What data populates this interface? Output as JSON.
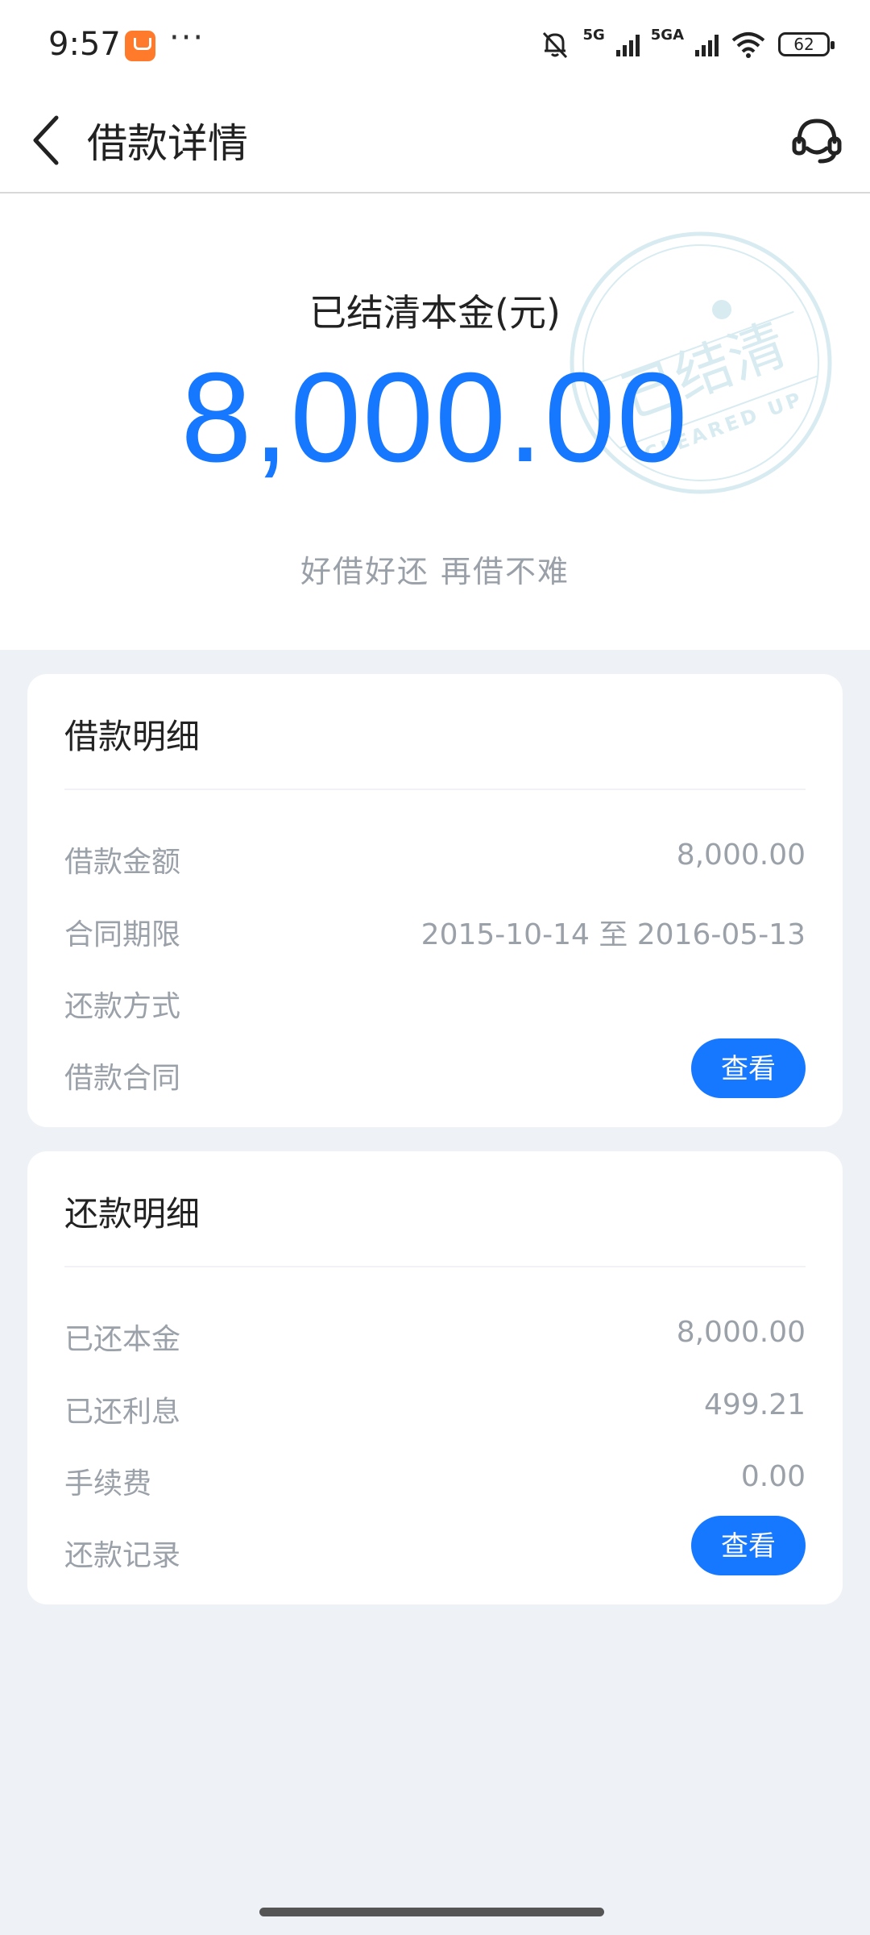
{
  "status_bar": {
    "time": "9:57",
    "more": "···",
    "network_1": "5G",
    "network_2": "5GA",
    "wifi_sub": "6",
    "battery": "62"
  },
  "nav": {
    "title": "借款详情",
    "back_icon": "chevron-left-icon",
    "service_icon": "headset-icon"
  },
  "hero": {
    "label": "已结清本金(元)",
    "amount": "8,000.00",
    "slogan": "好借好还 再借不难",
    "stamp_text": "已结清",
    "stamp_text_en": "CLEARED UP",
    "accent_color": "#1677ff"
  },
  "loan_detail": {
    "title": "借款明细",
    "rows": [
      {
        "label": "借款金额",
        "value": "8,000.00"
      },
      {
        "label": "合同期限",
        "value": "2015-10-14 至 2016-05-13"
      },
      {
        "label": "还款方式",
        "value": ""
      },
      {
        "label": "借款合同",
        "button": "查看"
      }
    ]
  },
  "repay_detail": {
    "title": "还款明细",
    "rows": [
      {
        "label": "已还本金",
        "value": "8,000.00"
      },
      {
        "label": "已还利息",
        "value": "499.21"
      },
      {
        "label": "手续费",
        "value": "0.00"
      },
      {
        "label": "还款记录",
        "button": "查看"
      }
    ]
  }
}
